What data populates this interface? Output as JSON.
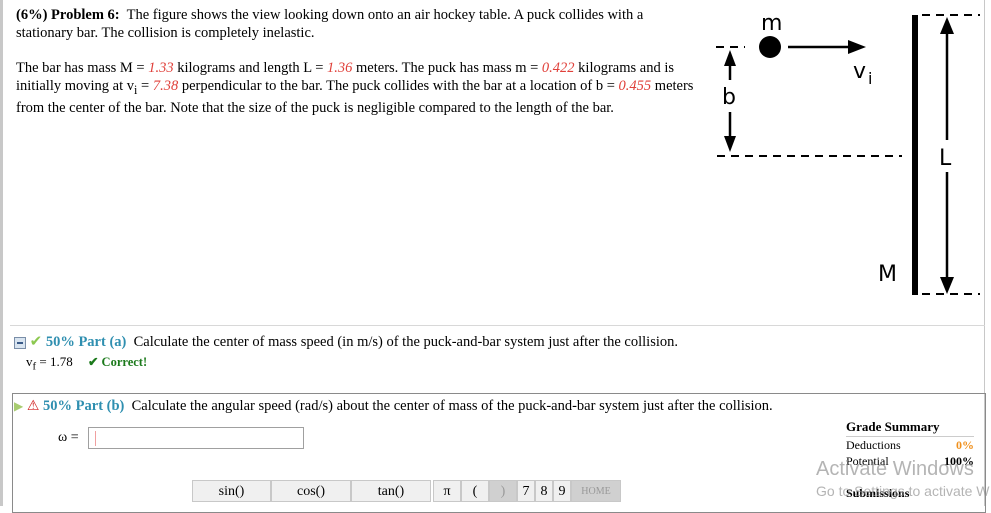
{
  "problem": {
    "weight": "(6%)",
    "title": "Problem 6:",
    "intro": "The figure shows the view looking down onto an air hockey table. A puck collides with a stationary bar. The collision is completely inelastic.",
    "text1": "The bar has mass M = ",
    "M": "1.33",
    "text2": " kilograms and length L = ",
    "L": "1.36",
    "text3": " meters. The puck has mass m = ",
    "m": "0.422",
    "text4": " kilograms and is initially moving at v",
    "vi_sub": "i",
    "text5": " = ",
    "vi": "7.38",
    "text6": " perpendicular to the bar. The puck collides with the bar at a location of b = ",
    "b": "0.455",
    "text7": " meters from the center of the bar. Note that the size of the puck is negligible compared to the length of the bar."
  },
  "figure": {
    "labels": {
      "m": "m",
      "vi": "v",
      "vi_sub": "i",
      "b": "b",
      "L": "L",
      "M": "M"
    }
  },
  "part_a": {
    "percent": "50%",
    "label": "Part (a)",
    "question": "Calculate the center of mass speed (in m/s) of the puck-and-bar system just after the collision.",
    "answer_var": "v",
    "answer_sub": "f",
    "answer": "= 1.78",
    "status": "✔ Correct!"
  },
  "part_b": {
    "percent": "50%",
    "label": "Part (b)",
    "question": "Calculate the angular speed (rad/s) about the center of mass of the puck-and-bar system just after the collision.",
    "input_label": "ω =",
    "input_value": ""
  },
  "keypad": {
    "keys": [
      "sin()",
      "cos()",
      "tan()",
      "π",
      "(",
      ")",
      "7",
      "8",
      "9",
      "HOME"
    ]
  },
  "grade_summary": {
    "title": "Grade Summary",
    "deductions_label": "Deductions",
    "deductions_value": "0%",
    "potential_label": "Potential",
    "potential_value": "100%",
    "submissions_label": "Submissions"
  },
  "watermark": {
    "line1": "Activate Windows",
    "line2": "Go to Settings to activate W"
  }
}
